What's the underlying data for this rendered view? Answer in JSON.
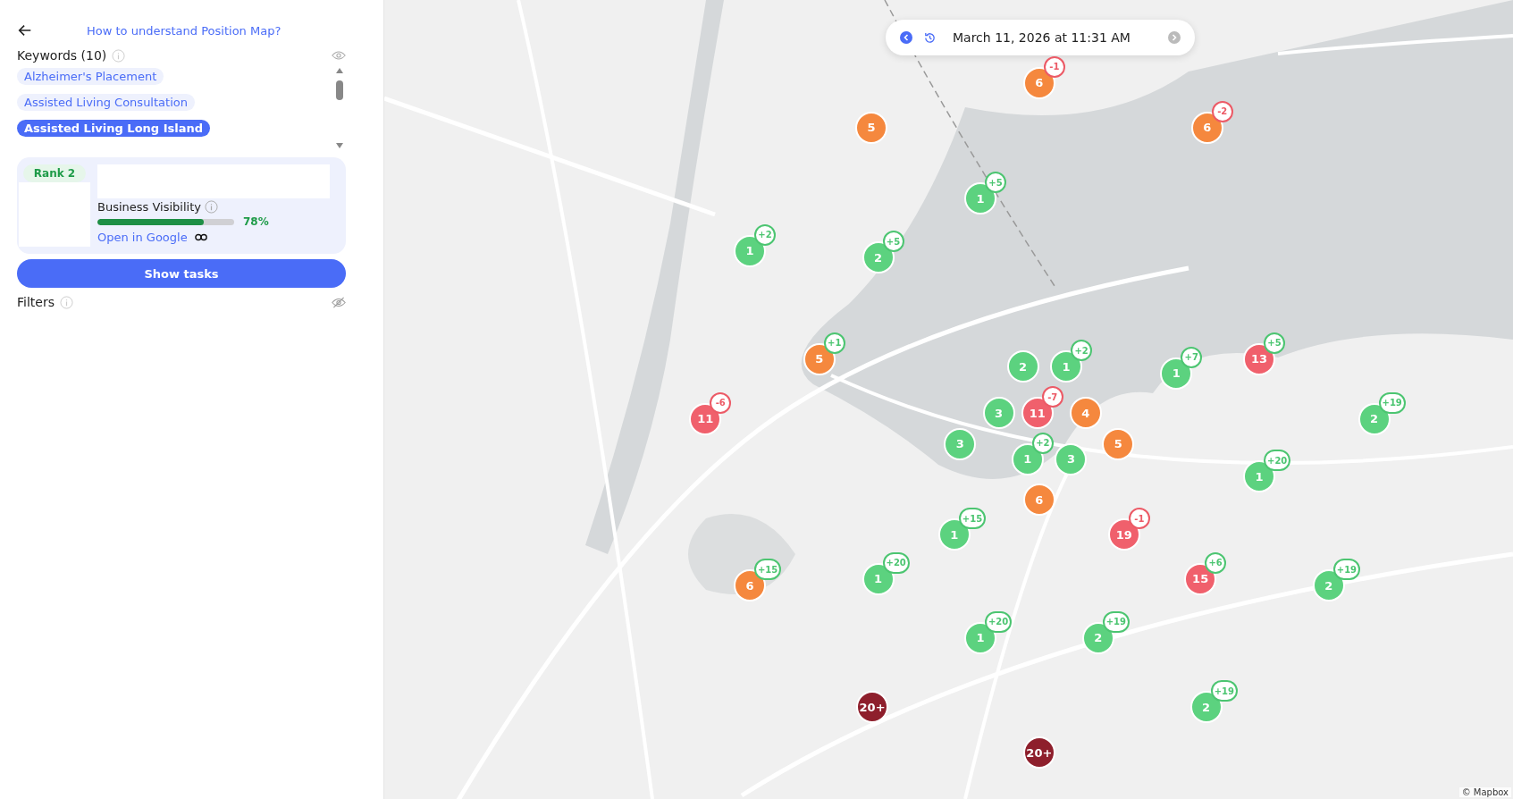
{
  "sidebar": {
    "help_link": "How to understand Position Map?",
    "keywords_label": "Keywords (10)",
    "keywords": [
      {
        "label": "Alzheimer's Placement",
        "selected": false
      },
      {
        "label": "Assisted Living Consultation",
        "selected": false
      },
      {
        "label": "Assisted Living Long Island",
        "selected": true
      }
    ],
    "card": {
      "rank": "Rank 2",
      "visibility_label": "Business Visibility",
      "level": 0.78,
      "percent": "78%",
      "link": "Open in Google"
    },
    "show_tasks": "Show tasks",
    "filters_label": "Filters"
  },
  "date_bar": {
    "text": "March 11, 2026 at 11:31 AM"
  },
  "pins": [
    {
      "rank": "6",
      "color": "#f5883e",
      "delta": {
        "text": "-1",
        "color": "#ec5a66"
      }
    },
    {
      "rank": "5",
      "color": "#f5883e"
    },
    {
      "rank": "6",
      "color": "#f5883e",
      "delta": {
        "text": "-2",
        "color": "#ec5a66"
      }
    },
    {
      "rank": "1",
      "color": "#5cd27f",
      "delta": {
        "text": "+5",
        "color": "#4cc571"
      }
    },
    {
      "rank": "1",
      "color": "#5cd27f",
      "delta": {
        "text": "+2",
        "color": "#4cc571"
      }
    },
    {
      "rank": "2",
      "color": "#5cd27f",
      "delta": {
        "text": "+5",
        "color": "#4cc571"
      }
    },
    {
      "rank": "5",
      "color": "#f5883e",
      "delta": {
        "text": "+1",
        "color": "#4cc571"
      }
    },
    {
      "rank": "2",
      "color": "#5cd27f"
    },
    {
      "rank": "1",
      "color": "#5cd27f",
      "delta": {
        "text": "+2",
        "color": "#4cc571"
      }
    },
    {
      "rank": "1",
      "color": "#5cd27f",
      "delta": {
        "text": "+7",
        "color": "#4cc571"
      }
    },
    {
      "rank": "13",
      "color": "#f0606c",
      "delta": {
        "text": "+5",
        "color": "#4cc571"
      }
    },
    {
      "rank": "11",
      "color": "#f0606c",
      "delta": {
        "text": "-6",
        "color": "#ec5a66"
      }
    },
    {
      "rank": "3",
      "color": "#5cd27f"
    },
    {
      "rank": "3",
      "color": "#5cd27f"
    },
    {
      "rank": "11",
      "color": "#f0606c",
      "delta": {
        "text": "-7",
        "color": "#ec5a66"
      }
    },
    {
      "rank": "4",
      "color": "#f5883e"
    },
    {
      "rank": "5",
      "color": "#f5883e"
    },
    {
      "rank": "2",
      "color": "#5cd27f",
      "delta": {
        "text": "+19",
        "color": "#4cc571"
      }
    },
    {
      "rank": "1",
      "color": "#5cd27f",
      "delta": {
        "text": "+2",
        "color": "#4cc571"
      }
    },
    {
      "rank": "3",
      "color": "#5cd27f"
    },
    {
      "rank": "1",
      "color": "#5cd27f",
      "delta": {
        "text": "+20",
        "color": "#4cc571"
      }
    },
    {
      "rank": "6",
      "color": "#f5883e"
    },
    {
      "rank": "1",
      "color": "#5cd27f",
      "delta": {
        "text": "+15",
        "color": "#4cc571"
      }
    },
    {
      "rank": "19",
      "color": "#f0606c",
      "delta": {
        "text": "-1",
        "color": "#ec5a66"
      }
    },
    {
      "rank": "6",
      "color": "#f5883e",
      "delta": {
        "text": "+15",
        "color": "#4cc571"
      }
    },
    {
      "rank": "1",
      "color": "#5cd27f",
      "delta": {
        "text": "+20",
        "color": "#4cc571"
      }
    },
    {
      "rank": "15",
      "color": "#f0606c",
      "delta": {
        "text": "+6",
        "color": "#4cc571"
      }
    },
    {
      "rank": "2",
      "color": "#5cd27f",
      "delta": {
        "text": "+19",
        "color": "#4cc571"
      }
    },
    {
      "rank": "1",
      "color": "#5cd27f",
      "delta": {
        "text": "+20",
        "color": "#4cc571"
      }
    },
    {
      "rank": "2",
      "color": "#5cd27f",
      "delta": {
        "text": "+19",
        "color": "#4cc571"
      }
    },
    {
      "rank": "20+",
      "color": "#8e1f2c"
    },
    {
      "rank": "2",
      "color": "#5cd27f",
      "delta": {
        "text": "+19",
        "color": "#4cc571"
      }
    },
    {
      "rank": "20+",
      "color": "#8e1f2c"
    }
  ],
  "attribution": "© Mapbox"
}
